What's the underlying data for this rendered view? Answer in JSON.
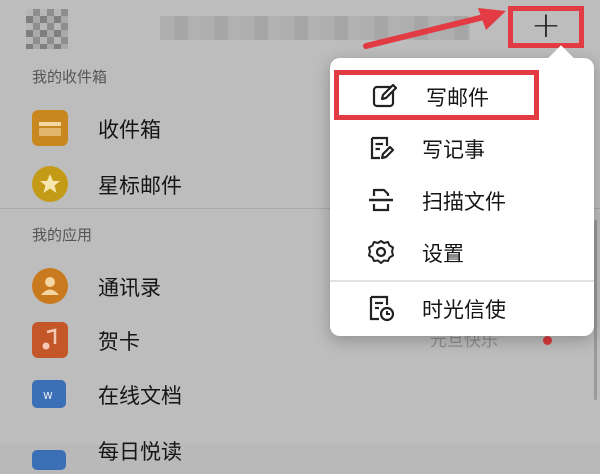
{
  "header": {
    "plus_symbol": "+"
  },
  "sections": {
    "mailbox_title": "我的收件箱",
    "apps_title": "我的应用"
  },
  "mailbox_items": [
    {
      "label": "收件箱",
      "icon": "inbox-tray-icon"
    },
    {
      "label": "星标邮件",
      "icon": "star-icon"
    }
  ],
  "app_items": [
    {
      "label": "通讯录",
      "icon": "contacts-icon"
    },
    {
      "label": "贺卡",
      "icon": "greeting-card-icon",
      "aside": "元旦快乐"
    },
    {
      "label": "在线文档",
      "icon": "document-icon"
    },
    {
      "label": "每日悦读",
      "icon": "news-icon"
    }
  ],
  "menu": {
    "items": [
      {
        "label": "写邮件",
        "icon": "compose-icon",
        "highlighted": true
      },
      {
        "label": "写记事",
        "icon": "note-icon"
      },
      {
        "label": "扫描文件",
        "icon": "scan-icon"
      },
      {
        "label": "设置",
        "icon": "gear-icon"
      },
      {
        "label": "时光信使",
        "icon": "time-letter-icon"
      }
    ]
  },
  "colors": {
    "highlight_red": "#e23b44",
    "inbox_orange": "#c9871f",
    "star_gold": "#c49b16",
    "doc_blue": "#3b6fb6",
    "menu_bg": "#ffffff",
    "overlay_gray": "#bdbdbd"
  }
}
